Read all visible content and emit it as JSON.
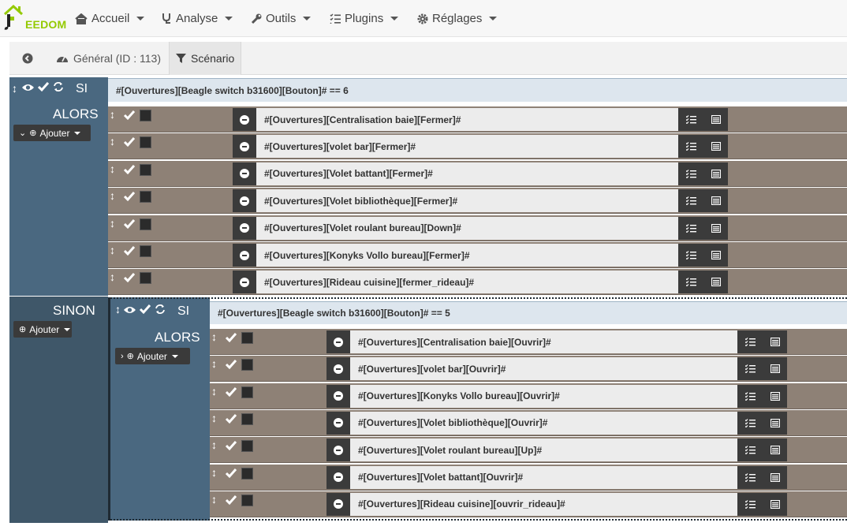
{
  "nav": {
    "logo_text": "EEDOM",
    "menus": [
      {
        "label": "Accueil",
        "icon": "home-icon"
      },
      {
        "label": "Analyse",
        "icon": "stethoscope-icon"
      },
      {
        "label": "Outils",
        "icon": "wrench-icon"
      },
      {
        "label": "Plugins",
        "icon": "tasks-icon"
      },
      {
        "label": "Réglages",
        "icon": "cog-icon"
      }
    ]
  },
  "tabs": {
    "back_icon": "arrow-circle-left-icon",
    "general": "Général (ID : 113)",
    "scenario": "Scénario"
  },
  "block1": {
    "si_label": "SI",
    "condition": "#[Ouvertures][Beagle switch b31600][Bouton]# == 6",
    "alors_label": "ALORS",
    "ajouter_label": "Ajouter",
    "actions": [
      "#[Ouvertures][Centralisation baie][Fermer]#",
      "#[Ouvertures][volet bar][Fermer]#",
      "#[Ouvertures][Volet battant][Fermer]#",
      "#[Ouvertures][Volet bibliothèque][Fermer]#",
      "#[Ouvertures][Volet roulant bureau][Down]#",
      "#[Ouvertures][Konyks Vollo bureau][Fermer]#",
      "#[Ouvertures][Rideau cuisine][fermer_rideau]#"
    ]
  },
  "sinon": {
    "label": "SINON",
    "ajouter_label": "Ajouter"
  },
  "block2": {
    "si_label": "SI",
    "condition": "#[Ouvertures][Beagle switch b31600][Bouton]# == 5",
    "alors_label": "ALORS",
    "ajouter_label": "Ajouter",
    "actions": [
      "#[Ouvertures][Centralisation baie][Ouvrir]#",
      "#[Ouvertures][volet bar][Ouvrir]#",
      "#[Ouvertures][Konyks Vollo bureau][Ouvrir]#",
      "#[Ouvertures][Volet bibliothèque][Ouvrir]#",
      "#[Ouvertures][Volet roulant bureau][Up]#",
      "#[Ouvertures][Volet battant][Ouvrir]#",
      "#[Ouvertures][Rideau cuisine][ouvrir_rideau]#"
    ]
  },
  "colors": {
    "brand_green": "#94ca02",
    "block_blue": "#4a6880",
    "action_brown": "#8e8176",
    "dark_button": "#3b3b3b"
  }
}
